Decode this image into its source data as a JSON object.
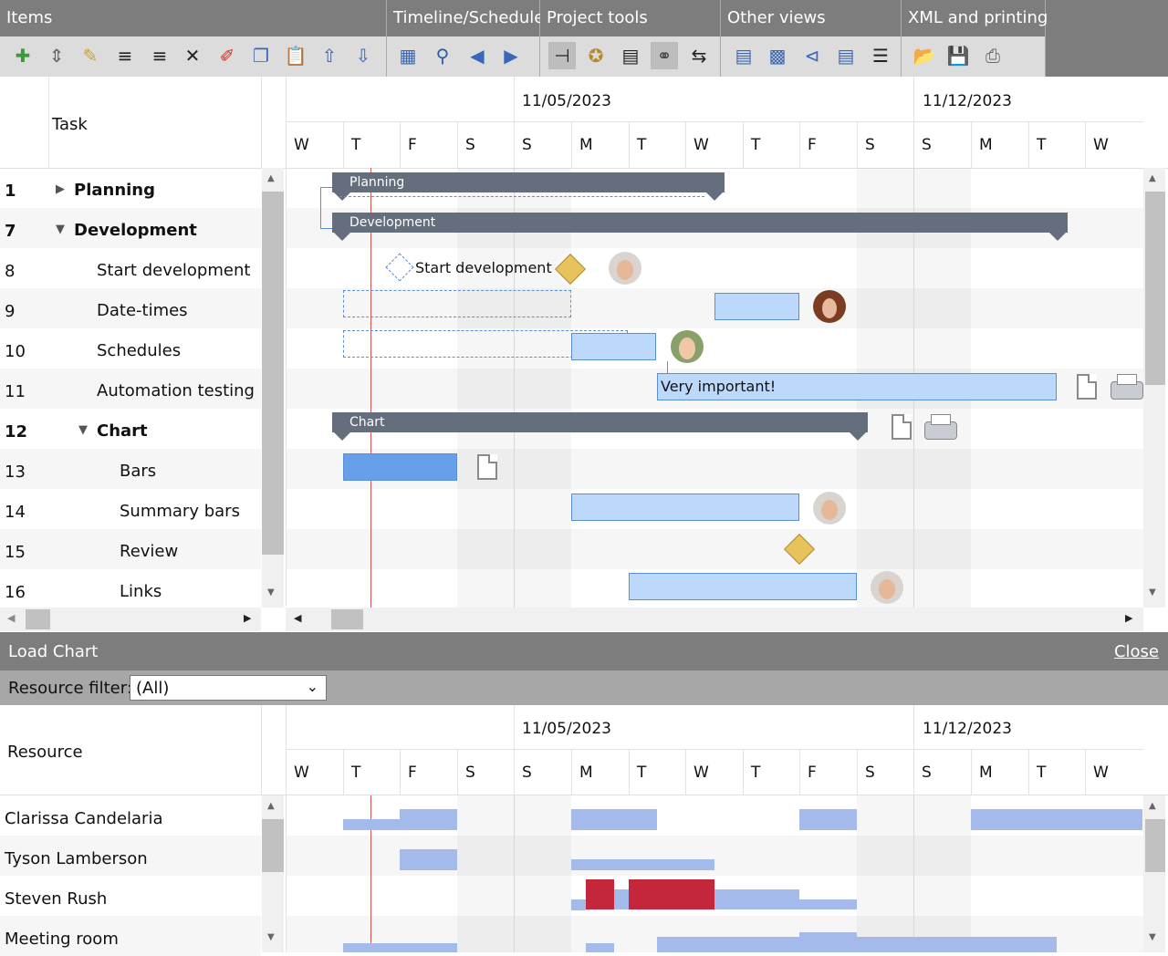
{
  "ribbon": {
    "groups": [
      {
        "title": "Items"
      },
      {
        "title": "Timeline/Schedule"
      },
      {
        "title": "Project tools"
      },
      {
        "title": "Other views"
      },
      {
        "title": "XML and printing"
      }
    ]
  },
  "grid": {
    "task_header": "Task",
    "rows": [
      {
        "num": "1",
        "name": "Planning",
        "bold": true
      },
      {
        "num": "7",
        "name": "Development",
        "bold": true
      },
      {
        "num": "8",
        "name": "Start development"
      },
      {
        "num": "9",
        "name": "Date-times"
      },
      {
        "num": "10",
        "name": "Schedules"
      },
      {
        "num": "11",
        "name": "Automation testing"
      },
      {
        "num": "12",
        "name": "Chart",
        "bold": true
      },
      {
        "num": "13",
        "name": "Bars"
      },
      {
        "num": "14",
        "name": "Summary bars"
      },
      {
        "num": "15",
        "name": "Review"
      },
      {
        "num": "16",
        "name": "Links"
      }
    ]
  },
  "timeline": {
    "dates": [
      "11/05/2023",
      "11/12/2023"
    ],
    "days": [
      "W",
      "T",
      "F",
      "S",
      "S",
      "M",
      "T",
      "W",
      "T",
      "F",
      "S",
      "S",
      "M",
      "T",
      "W"
    ]
  },
  "chart_labels": {
    "planning": "Planning",
    "development": "Development",
    "start_development": "Start development",
    "very_important": "Very important!",
    "chart": "Chart"
  },
  "load_chart": {
    "title": "Load Chart",
    "close": "Close",
    "filter_label": "Resource filter:",
    "filter_value": "(All)",
    "resource_header": "Resource",
    "resources": [
      "Clarissa Candelaria",
      "Tyson Lamberson",
      "Steven Rush",
      "Meeting room"
    ]
  },
  "colors": {
    "summary": "#646e7d",
    "bar": "#bcd8fb",
    "bar_dark": "#66a0eb",
    "milestone": "#e8c35c",
    "overload": "#c4263b",
    "load": "#a4baeb"
  }
}
